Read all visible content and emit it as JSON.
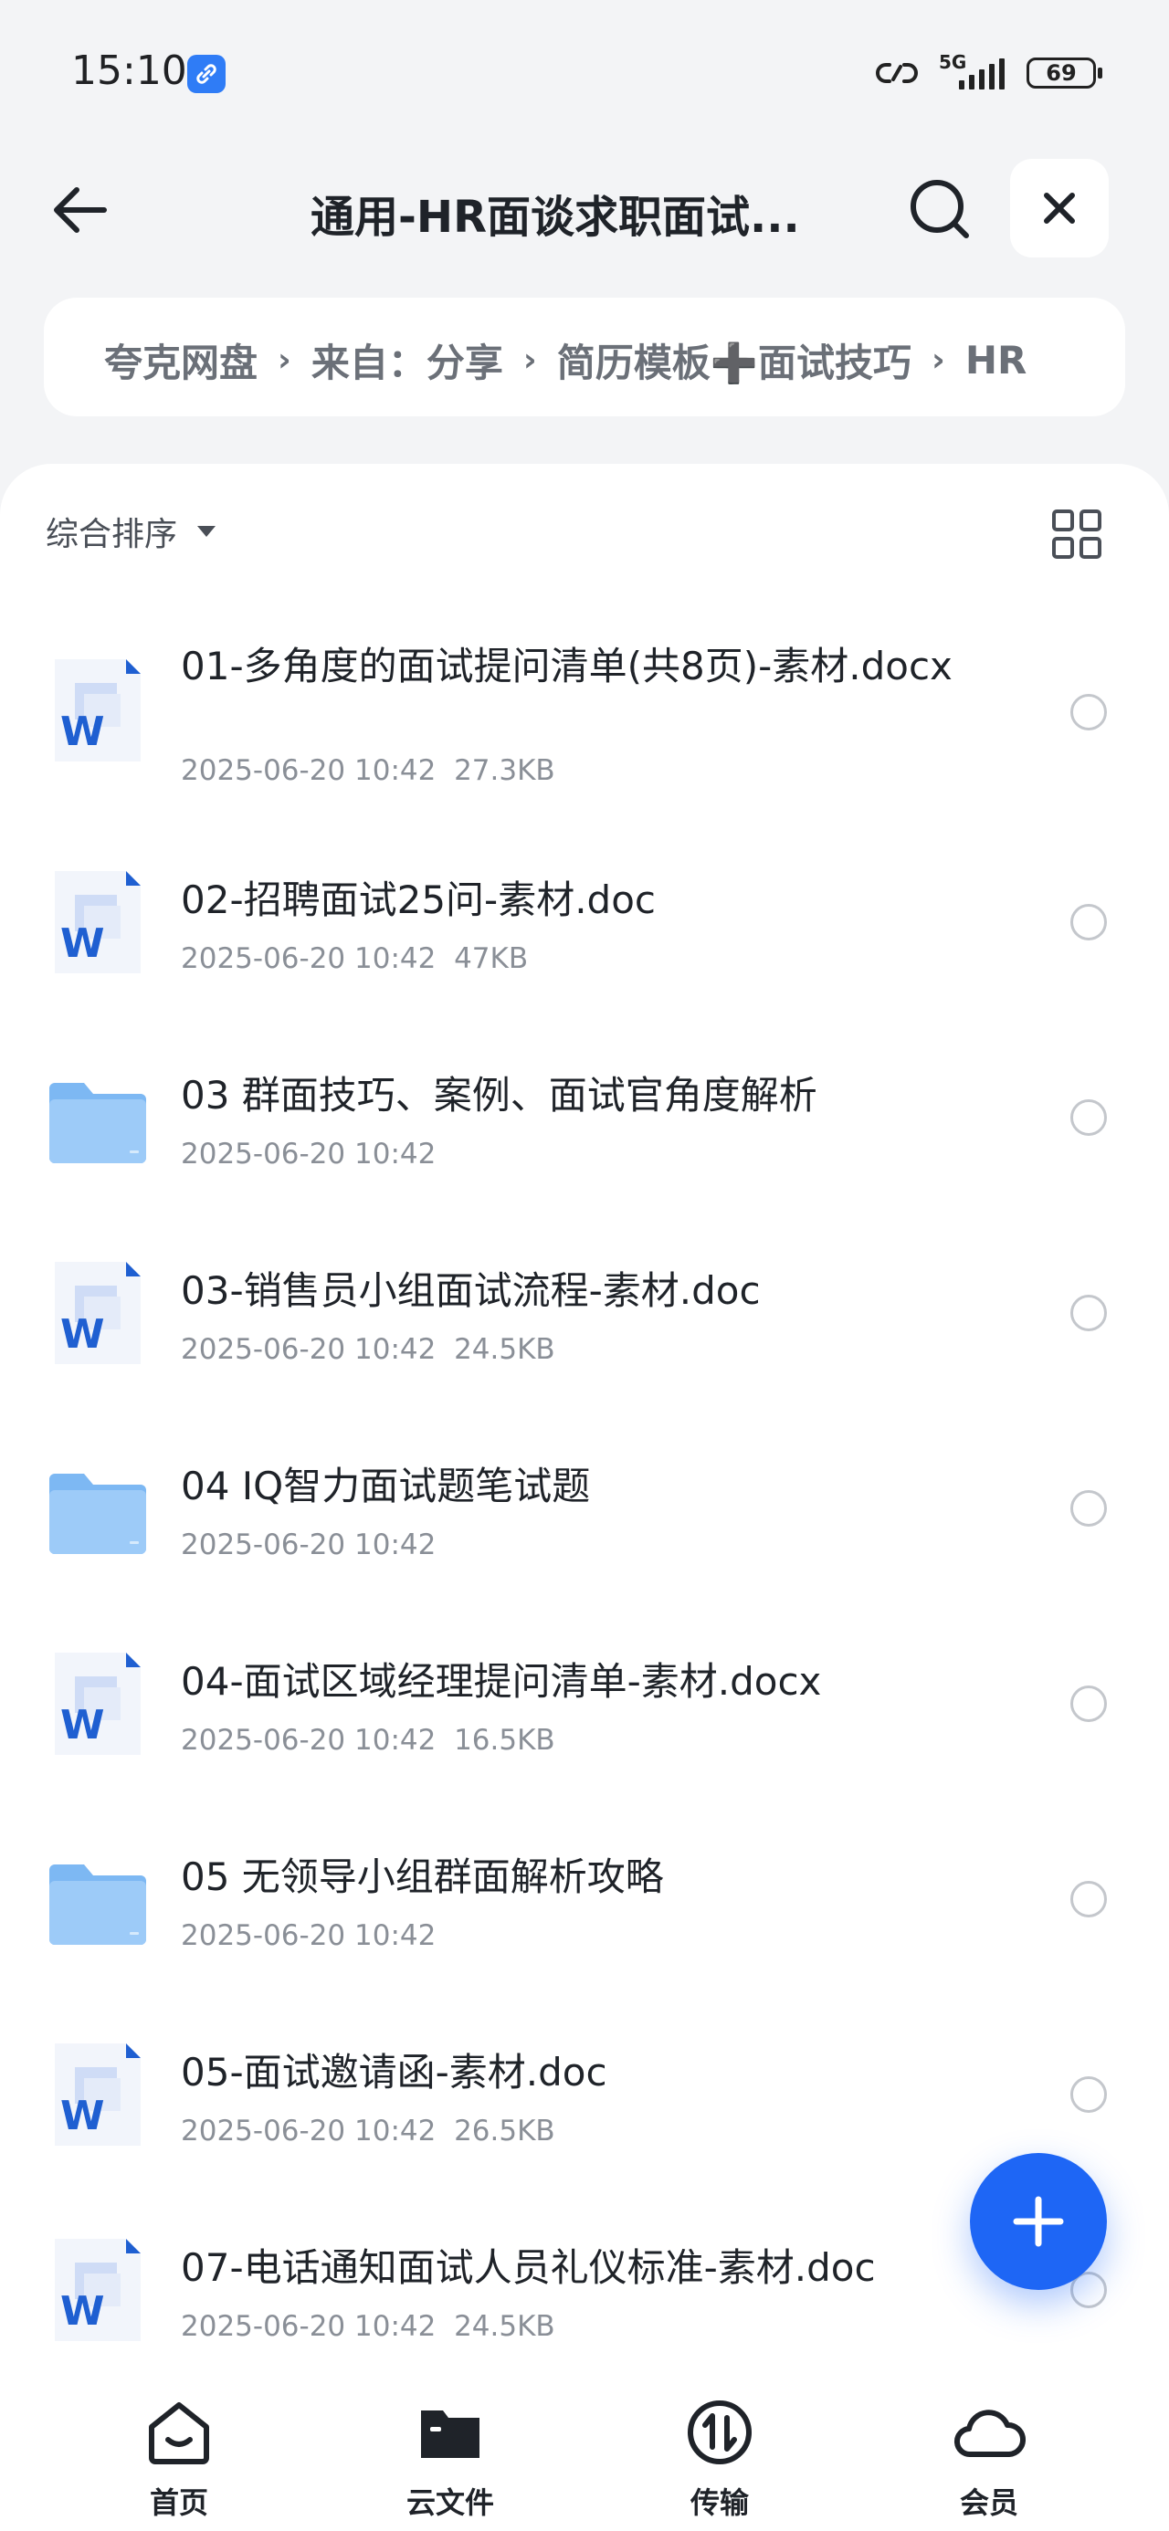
{
  "status_bar": {
    "time": "15:10",
    "network": "5G",
    "battery": "69"
  },
  "header": {
    "title": "通用-HR面谈求职面试..."
  },
  "breadcrumb": [
    "夸克网盘",
    "来自：分享",
    "简历模板➕面试技巧",
    "HR"
  ],
  "sort": {
    "label": "综合排序"
  },
  "files": [
    {
      "name": "01-多角度的面试提问清单(共8页)-素材.docx",
      "date": "2025-06-20 10:42",
      "size": "27.3KB",
      "type": "word"
    },
    {
      "name": "02-招聘面试25问-素材.doc",
      "date": "2025-06-20 10:42",
      "size": "47KB",
      "type": "word"
    },
    {
      "name": "03 群面技巧、案例、面试官角度解析",
      "date": "2025-06-20 10:42",
      "size": "",
      "type": "folder"
    },
    {
      "name": "03-销售员小组面试流程-素材.doc",
      "date": "2025-06-20 10:42",
      "size": "24.5KB",
      "type": "word"
    },
    {
      "name": "04 IQ智力面试题笔试题",
      "date": "2025-06-20 10:42",
      "size": "",
      "type": "folder"
    },
    {
      "name": "04-面试区域经理提问清单-素材.docx",
      "date": "2025-06-20 10:42",
      "size": "16.5KB",
      "type": "word"
    },
    {
      "name": "05 无领导小组群面解析攻略",
      "date": "2025-06-20 10:42",
      "size": "",
      "type": "folder"
    },
    {
      "name": "05-面试邀请函-素材.doc",
      "date": "2025-06-20 10:42",
      "size": "26.5KB",
      "type": "word"
    },
    {
      "name": "07-电话通知面试人员礼仪标准-素材.doc",
      "date": "2025-06-20 10:42",
      "size": "24.5KB",
      "type": "word"
    }
  ],
  "bottom_nav": [
    {
      "label": "首页",
      "icon": "home-icon"
    },
    {
      "label": "云文件",
      "icon": "cloud-folder-icon"
    },
    {
      "label": "传输",
      "icon": "transfer-icon"
    },
    {
      "label": "会员",
      "icon": "member-cloud-icon"
    }
  ],
  "colors": {
    "accent": "#1e66f5",
    "background": "#f3f4f6",
    "folder": "#8cc4f8",
    "word": "#1f5fd1"
  }
}
